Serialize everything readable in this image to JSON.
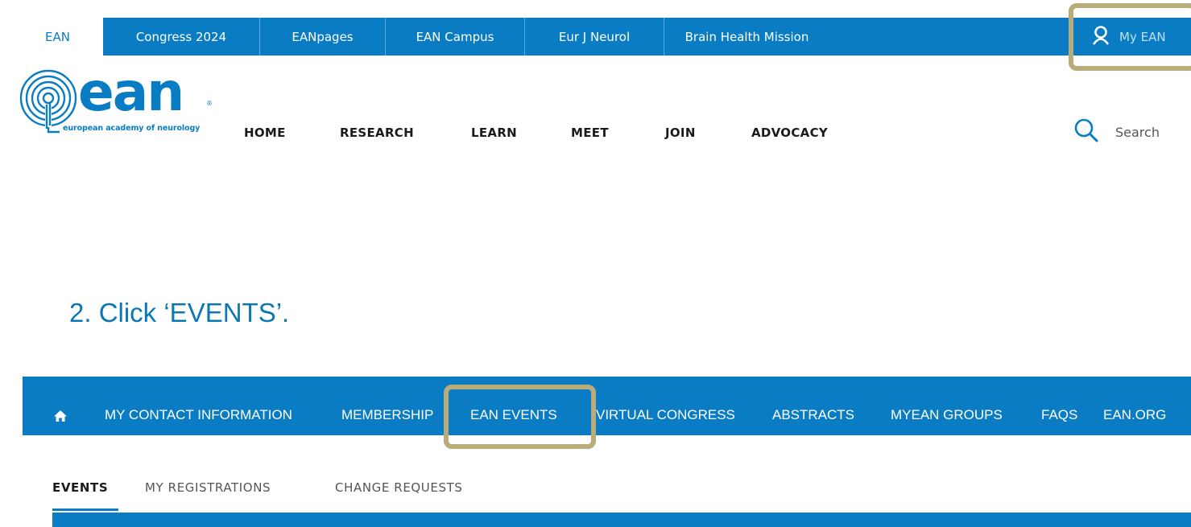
{
  "topbar": {
    "tabs": [
      {
        "label": "EAN",
        "active": true
      },
      {
        "label": "Congress 2024"
      },
      {
        "label": "EANpages"
      },
      {
        "label": "EAN Campus"
      },
      {
        "label": "Eur J Neurol"
      },
      {
        "label": "Brain Health Mission"
      }
    ],
    "my_ean_label": "My EAN",
    "my_ean_icon": "user-icon"
  },
  "logo": {
    "word": "ean",
    "registered": "®",
    "tagline": "european academy of neurology"
  },
  "main_nav": {
    "items": [
      "HOME",
      "RESEARCH",
      "LEARN",
      "MEET",
      "JOIN",
      "ADVOCACY"
    ],
    "search_label": "Search",
    "search_icon": "search-icon"
  },
  "instruction": {
    "text": "2. Click ‘EVENTS’."
  },
  "secondary_nav": {
    "home_icon": "home-icon",
    "items": [
      "MY CONTACT INFORMATION",
      "MEMBERSHIP",
      "EAN EVENTS",
      "VIRTUAL CONGRESS",
      "ABSTRACTS",
      "MYEAN GROUPS",
      "FAQS",
      "EAN.ORG"
    ],
    "active_item": "EAN EVENTS"
  },
  "sub_tabs": {
    "items": [
      "EVENTS",
      "MY REGISTRATIONS",
      "CHANGE REQUESTS"
    ],
    "active_item": "EVENTS"
  },
  "colors": {
    "brand_blue": "#0a7cc3",
    "highlight": "#b9ab7a",
    "instruction_text": "#0b78b5"
  }
}
